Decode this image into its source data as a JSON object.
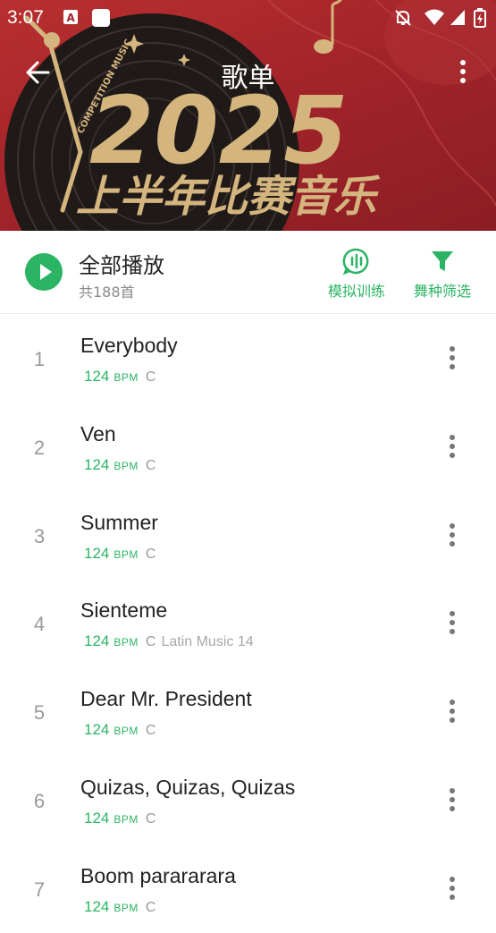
{
  "status_bar": {
    "time": "3:07",
    "icons": [
      "app-a-icon",
      "square-app-icon",
      "bell-off-icon",
      "wifi-icon",
      "signal-icon",
      "battery-charging-icon"
    ]
  },
  "header": {
    "title": "歌单",
    "banner_year": "2025",
    "banner_subtitle": "上半年比赛音乐",
    "banner_ring_text": "COMPETITION MUSIC",
    "colors": {
      "banner": "#a3242b",
      "gold": "#d4b57e"
    }
  },
  "play_all": {
    "label": "全部播放",
    "count": "共188首",
    "actions": [
      {
        "label": "模拟训练",
        "icon": "audio-wave-icon"
      },
      {
        "label": "舞种筛选",
        "icon": "filter-icon"
      }
    ]
  },
  "colors": {
    "accent": "#2bb463"
  },
  "songs": [
    {
      "index": "1",
      "title": "Everybody",
      "bpm": "124",
      "bpm_unit": "BPM",
      "key": "C",
      "tag": ""
    },
    {
      "index": "2",
      "title": "Ven",
      "bpm": "124",
      "bpm_unit": "BPM",
      "key": "C",
      "tag": ""
    },
    {
      "index": "3",
      "title": "Summer",
      "bpm": "124",
      "bpm_unit": "BPM",
      "key": "C",
      "tag": ""
    },
    {
      "index": "4",
      "title": "Sienteme",
      "bpm": "124",
      "bpm_unit": "BPM",
      "key": "C",
      "tag": "Latin Music 14"
    },
    {
      "index": "5",
      "title": "Dear Mr. President",
      "bpm": "124",
      "bpm_unit": "BPM",
      "key": "C",
      "tag": ""
    },
    {
      "index": "6",
      "title": "Quizas, Quizas, Quizas",
      "bpm": "124",
      "bpm_unit": "BPM",
      "key": "C",
      "tag": ""
    },
    {
      "index": "7",
      "title": "Boom parararara",
      "bpm": "124",
      "bpm_unit": "BPM",
      "key": "C",
      "tag": ""
    }
  ]
}
